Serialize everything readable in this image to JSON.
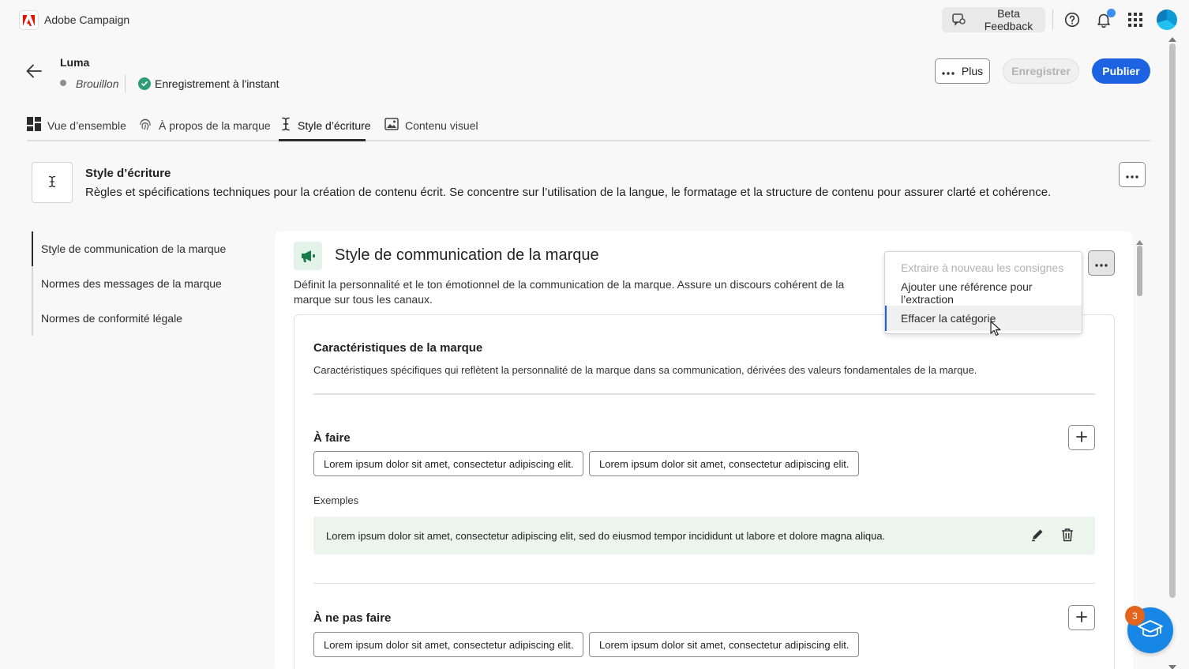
{
  "app": {
    "name": "Adobe Campaign"
  },
  "topbar": {
    "beta_feedback": "Beta Feedback"
  },
  "header": {
    "title": "Luma",
    "status": "Brouillon",
    "save_status": "Enregistrement à l'instant",
    "more_label": "Plus",
    "save_label": "Enregistrer",
    "publish_label": "Publier"
  },
  "tabs": [
    {
      "label": "Vue d’ensemble",
      "icon": "dashboard-icon"
    },
    {
      "label": "À propos de la marque",
      "icon": "fingerprint-icon"
    },
    {
      "label": "Style d’écriture",
      "icon": "text-cursor-icon",
      "active": true
    },
    {
      "label": "Contenu visuel",
      "icon": "image-icon"
    }
  ],
  "section": {
    "title": "Style d’écriture",
    "description": "Règles et spécifications techniques pour la création de contenu écrit. Se concentre sur l’utilisation de la langue, le formatage et la structure de contenu pour assurer clarté et cohérence."
  },
  "nav": {
    "items": [
      {
        "label": "Style de communication de la marque",
        "active": true
      },
      {
        "label": "Normes des messages de la marque"
      },
      {
        "label": "Normes de conformité légale"
      }
    ]
  },
  "category": {
    "title": "Style de communication de la marque",
    "description": "Définit la personnalité et le ton émotionnel de la communication de la marque. Assure un discours cohérent de la marque sur tous les canaux."
  },
  "menu": {
    "items": [
      {
        "label": "Extraire à nouveau les consignes",
        "disabled": true
      },
      {
        "label": "Ajouter une référence pour l’extraction"
      },
      {
        "label": "Effacer la catégorie",
        "hovered": true
      }
    ]
  },
  "characteristics": {
    "title": "Caractéristiques de la marque",
    "description": "Caractéristiques spécifiques qui reflètent la personnalité de la marque dans sa communication, dérivées des valeurs fondamentales de la marque."
  },
  "do": {
    "title": "À faire",
    "tags": [
      "Lorem ipsum dolor sit amet, consectetur adipiscing elit.",
      "Lorem ipsum dolor sit amet, consectetur adipiscing elit."
    ],
    "examples_label": "Exemples",
    "example": "Lorem ipsum dolor sit amet, consectetur adipiscing elit, sed do eiusmod tempor incididunt ut labore et dolore magna aliqua."
  },
  "dont": {
    "title": "À ne pas faire",
    "tags": [
      "Lorem ipsum dolor sit amet, consectetur adipiscing elit.",
      "Lorem ipsum dolor sit amet, consectetur adipiscing elit."
    ]
  },
  "learn": {
    "badge_count": "3"
  },
  "colors": {
    "accent": "#1d63e1",
    "adobe_red": "#eb1000",
    "success": "#2d9d78",
    "example_bg": "#ebf5ee",
    "badge": "#e3651d"
  }
}
